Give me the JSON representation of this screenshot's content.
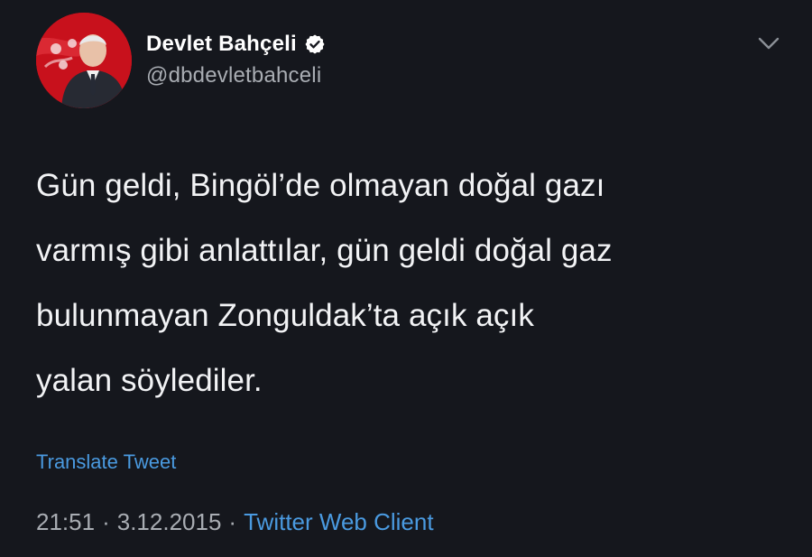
{
  "author": {
    "display_name": "Devlet Bahçeli",
    "handle": "@dbdevletbahceli",
    "verified": true,
    "avatar_icon": "profile-photo-flag-background"
  },
  "tweet": {
    "text": "Gün geldi, Bingöl’de olmayan doğal gazı\nvarmış gibi anlattılar, gün geldi doğal gaz\nbulunmayan Zonguldak’ta açık açık\nyalan söylediler.",
    "translate_label": "Translate Tweet",
    "time": "21:51",
    "date": "3.12.2015",
    "separator": "·",
    "source": "Twitter Web Client"
  },
  "icons": {
    "menu": "chevron-down-icon",
    "verified": "verified-badge-icon"
  },
  "colors": {
    "background": "#15171d",
    "text": "#f2f3f5",
    "secondary": "#a9adb3",
    "link": "#4a9ae0",
    "avatar_red": "#c8111c"
  }
}
